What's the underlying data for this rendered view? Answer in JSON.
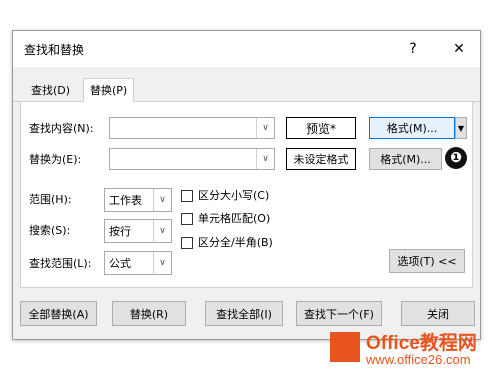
{
  "dialog": {
    "title": "查找和替换",
    "help_label": "?",
    "close_label": "✕"
  },
  "tabs": [
    {
      "label": "查找(D)"
    },
    {
      "label": "替换(P)"
    }
  ],
  "find": {
    "label": "查找内容(N):",
    "value": "",
    "preview_label": "预览*",
    "format_label": "格式(M)..."
  },
  "replace": {
    "label": "替换为(E):",
    "value": "",
    "preview_label": "未设定格式",
    "format_label": "格式(M)..."
  },
  "options": {
    "within_label": "范围(H):",
    "within_value": "工作表",
    "search_label": "搜索(S):",
    "search_value": "按行",
    "lookin_label": "查找范围(L):",
    "lookin_value": "公式",
    "match_case": "区分大小写(C)",
    "match_cell": "单元格匹配(O)",
    "match_byte": "区分全/半角(B)",
    "options_button": "选项(T) <<"
  },
  "footer": {
    "replace_all": "全部替换(A)",
    "replace": "替换(R)",
    "find_all": "查找全部(I)",
    "find_next": "查找下一个(F)",
    "close": "关闭"
  },
  "annotation": {
    "marker": "❶"
  },
  "watermark": {
    "brand": "Office教程网",
    "url": "www.office26.com",
    "color": "#e8541e"
  }
}
